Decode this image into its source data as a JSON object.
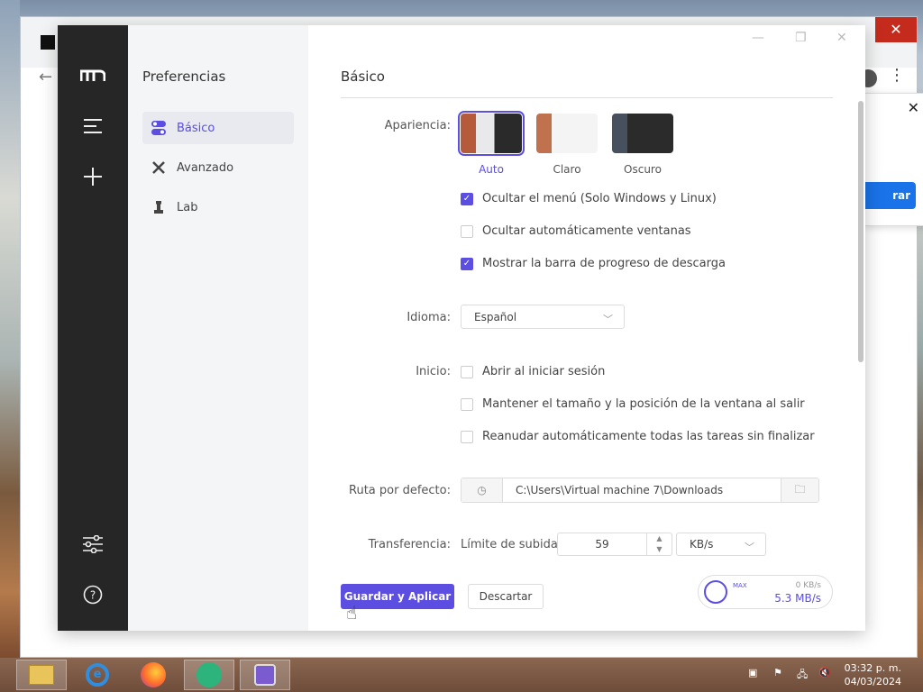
{
  "sidebar": {
    "title": "Preferencias",
    "items": [
      {
        "label": "Básico",
        "icon": "toggle-icon",
        "active": true
      },
      {
        "label": "Avanzado",
        "icon": "wrench-icon",
        "active": false
      },
      {
        "label": "Lab",
        "icon": "flask-icon",
        "active": false
      }
    ]
  },
  "main": {
    "title": "Básico",
    "apariencia": {
      "label": "Apariencia:",
      "themes": [
        {
          "name": "Auto",
          "selected": true
        },
        {
          "name": "Claro",
          "selected": false
        },
        {
          "name": "Oscuro",
          "selected": false
        }
      ],
      "options": [
        {
          "label": "Ocultar el menú (Solo Windows y Linux)",
          "checked": true
        },
        {
          "label": "Ocultar automáticamente ventanas",
          "checked": false
        },
        {
          "label": "Mostrar la barra de progreso de descarga",
          "checked": true
        }
      ]
    },
    "idioma": {
      "label": "Idioma:",
      "value": "Español"
    },
    "inicio": {
      "label": "Inicio:",
      "options": [
        {
          "label": "Abrir al iniciar sesión",
          "checked": false
        },
        {
          "label": "Mantener el tamaño y la posición de la ventana al salir",
          "checked": false
        },
        {
          "label": "Reanudar automáticamente todas las tareas sin finalizar",
          "checked": false
        }
      ]
    },
    "ruta": {
      "label": "Ruta por defecto:",
      "value": "C:\\Users\\Virtual machine 7\\Downloads"
    },
    "transferencia": {
      "label": "Transferencia:",
      "sublabel": "Límite de subida",
      "value": "59",
      "unit": "KB/s"
    },
    "save_label": "Guardar y Aplicar",
    "discard_label": "Descartar",
    "speed": {
      "max": "MAX",
      "upload": "0 KB/s",
      "download": "5.3 MB/s"
    }
  },
  "taskbar": {
    "time": "03:32 p. m.",
    "date": "04/03/2024"
  },
  "colors": {
    "accent": "#5b4ee0",
    "rail": "#262626"
  }
}
